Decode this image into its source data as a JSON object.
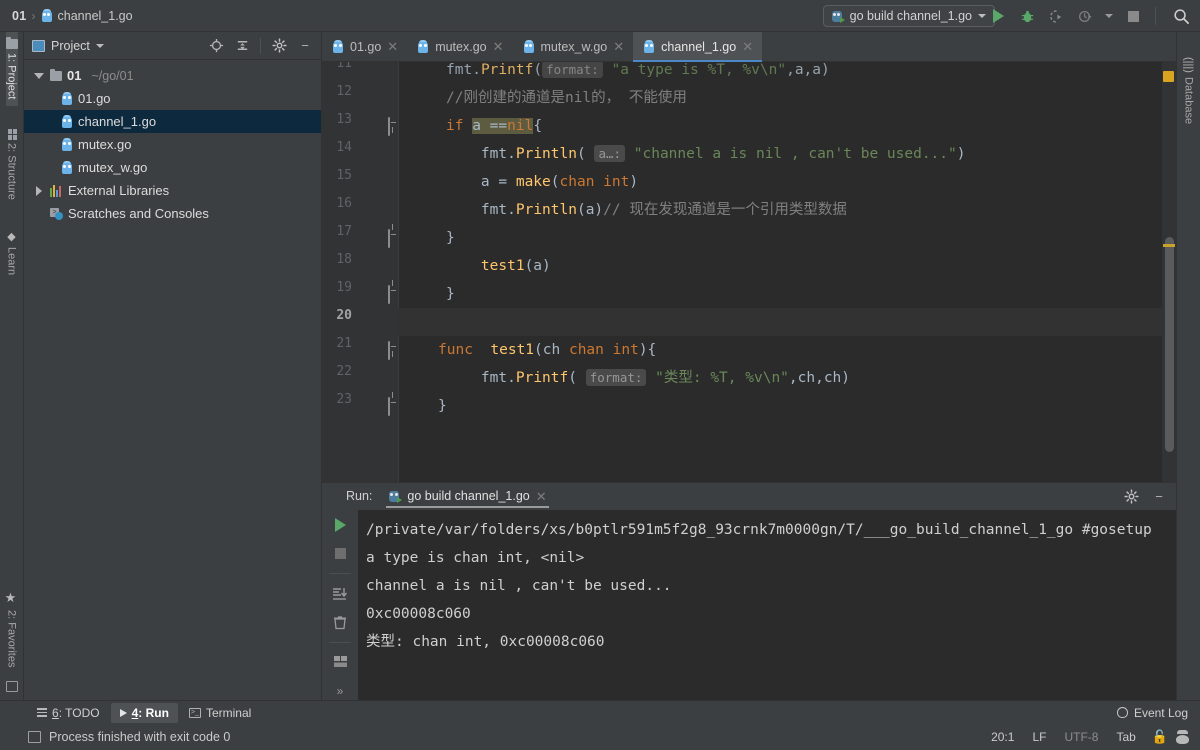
{
  "breadcrumb": {
    "project": "01",
    "separator": "›",
    "file": "channel_1.go"
  },
  "toolbar": {
    "run_config": "go build channel_1.go",
    "icons": [
      "run-icon",
      "debug-icon",
      "run-coverage-icon",
      "profile-icon",
      "stop-icon",
      "search-everywhere-icon"
    ]
  },
  "left_strip": {
    "project": "1: Project",
    "structure": "2: Structure",
    "learn": "Learn",
    "favorites": "2: Favorites"
  },
  "right_strip": {
    "database": "Database"
  },
  "project_panel": {
    "title": "Project",
    "tree": [
      {
        "label": "01",
        "path": "~/go/01",
        "type": "folder",
        "expanded": true,
        "selected": false
      },
      {
        "label": "01.go",
        "path": "",
        "type": "go-file",
        "expanded": false,
        "selected": false
      },
      {
        "label": "channel_1.go",
        "path": "",
        "type": "go-file",
        "expanded": false,
        "selected": true
      },
      {
        "label": "mutex.go",
        "path": "",
        "type": "go-file",
        "expanded": false,
        "selected": false
      },
      {
        "label": "mutex_w.go",
        "path": "",
        "type": "go-file",
        "expanded": false,
        "selected": false
      },
      {
        "label": "External Libraries",
        "path": "",
        "type": "library",
        "expanded": false,
        "selected": false
      },
      {
        "label": "Scratches and Consoles",
        "path": "",
        "type": "scratch",
        "expanded": false,
        "selected": false
      }
    ]
  },
  "editor": {
    "tabs": [
      {
        "label": "01.go",
        "active": false
      },
      {
        "label": "mutex.go",
        "active": false
      },
      {
        "label": "mutex_w.go",
        "active": false
      },
      {
        "label": "channel_1.go",
        "active": true
      }
    ],
    "line_numbers": [
      "11",
      "12",
      "13",
      "14",
      "15",
      "16",
      "17",
      "18",
      "19",
      "20",
      "21",
      "22",
      "23"
    ],
    "current_line": "20",
    "lines": [
      {
        "n": "11",
        "clipped": true
      },
      {
        "n": "12",
        "text": "//刚创建的通道是nil的， 不能使用"
      },
      {
        "n": "13",
        "text": "if a ==nil{"
      },
      {
        "n": "14",
        "text": "fmt.Println( a…: \"channel a is nil , can't be used...\")"
      },
      {
        "n": "15",
        "text": "a = make(chan int)"
      },
      {
        "n": "16",
        "text": "fmt.Println(a)// 现在发现通道是一个引用类型数据"
      },
      {
        "n": "17",
        "text": "}"
      },
      {
        "n": "18",
        "text": "test1(a)"
      },
      {
        "n": "19",
        "text": "}"
      },
      {
        "n": "20",
        "text": ""
      },
      {
        "n": "21",
        "text": "func  test1(ch chan int){"
      },
      {
        "n": "22",
        "text": "fmt.Printf( format: \"类型: %T, %v\\n\",ch,ch)"
      },
      {
        "n": "23",
        "text": "}"
      }
    ],
    "hint_14": "a…:",
    "hint_22": "format:"
  },
  "run_panel": {
    "label": "Run:",
    "tab": "go build channel_1.go",
    "output": [
      "/private/var/folders/xs/b0ptlr591m5f2g8_93crnk7m0000gn/T/___go_build_channel_1_go #gosetup",
      "a type is chan int, <nil>",
      "channel a is nil , can't be used...",
      "0xc00008c060",
      "类型: chan int, 0xc00008c060"
    ],
    "side_icons": [
      "rerun-icon",
      "stop-icon",
      "scroll-to-end-icon",
      "trash-icon",
      "layout-icon",
      "more-icon"
    ],
    "head_icons": [
      "settings-icon",
      "hide-icon"
    ]
  },
  "bottom_bar": {
    "items": [
      {
        "num": "6",
        "label": ": TODO",
        "icon": "list-icon",
        "active": false
      },
      {
        "num": "4",
        "label": ": Run",
        "icon": "run-icon",
        "active": true
      },
      {
        "num": "",
        "label": "Terminal",
        "icon": "terminal-icon",
        "active": false
      }
    ],
    "event_log": "Event Log"
  },
  "status_bar": {
    "message": "Process finished with exit code 0",
    "caret": "20:1",
    "line_sep": "LF",
    "encoding": "UTF-8",
    "indent": "Tab",
    "lock": "🔓",
    "face": "face-icon"
  },
  "colors": {
    "accent": "#4a88c7",
    "selection": "#0d293e",
    "editor_bg": "#2b2b2b",
    "panel_bg": "#3c3f41",
    "keyword": "#cc7832",
    "string": "#6a8759",
    "function": "#ffc66d",
    "comment": "#808080",
    "warning": "#d9a520",
    "run_green": "#59a869"
  }
}
